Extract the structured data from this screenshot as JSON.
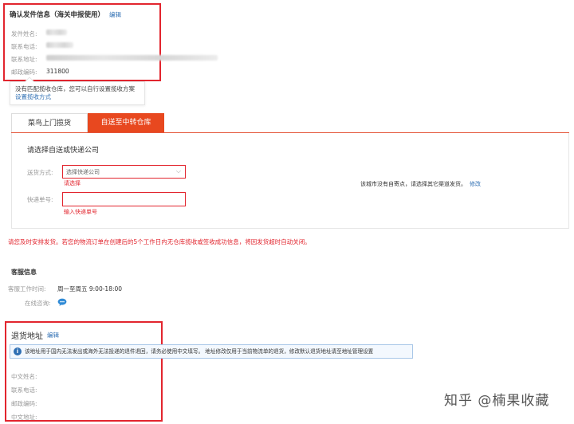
{
  "sender": {
    "title": "确认发件信息（海关申报使用）",
    "edit_label": "编辑",
    "fields": [
      {
        "label": "发件姓名:",
        "value": ""
      },
      {
        "label": "联系电话:",
        "value": ""
      },
      {
        "label": "联系地址:",
        "value": ""
      },
      {
        "label": "邮政编码:",
        "value": "311800"
      }
    ]
  },
  "tooltip": {
    "text": "没有匹配揽收仓库，您可以自行设置揽收方案",
    "link": "设置揽收方式"
  },
  "tabs": [
    {
      "label": "菜鸟上门揽货",
      "active": false
    },
    {
      "label": "自送至中转仓库",
      "active": true
    }
  ],
  "courier": {
    "title": "请选择自送或快递公司",
    "shipping_label": "送货方式:",
    "select_placeholder": "选择快递公司",
    "select_error": "请选择",
    "tracking_label": "快递单号:",
    "tracking_error": "输入快递单号",
    "no_station_text": "该城市没有自寄点，请选择其它渠道发货。",
    "modify_label": "修改"
  },
  "warning": "请您及时安排发货。若您的物流订单在创建后的5个工作日内无仓库揽收或签收成功信息，将因发货超时自动关闭。",
  "customer_service": {
    "title": "客服信息",
    "hours_label": "客服工作时间:",
    "hours_value": "周一至周五 9:00-18:00",
    "online_label": "在线咨询:",
    "icon": "chat-bubble-icon"
  },
  "return_address": {
    "title": "退货地址",
    "edit_label": "编辑",
    "notice": "该地址用于国内无法发出或海外无法投递的退件退回，请务必使用中文填写。 地址修改仅用于当前物流单的退货，修改默认退货地址请至地址管理设置",
    "fields": [
      {
        "label": "中文姓名:"
      },
      {
        "label": "联系电话:"
      },
      {
        "label": "邮政编码:"
      },
      {
        "label": "中文地址:"
      }
    ]
  },
  "watermark": "知乎 @楠果收藏",
  "colors": {
    "highlight_border": "#e2252e",
    "active_tab": "#e8481f",
    "link": "#2f6fb3",
    "error_text": "#e2252e"
  }
}
